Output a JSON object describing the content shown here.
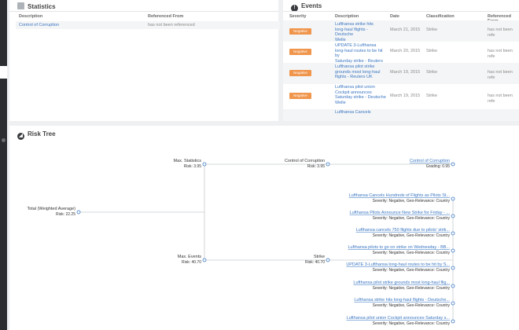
{
  "statistics": {
    "title": "Statistics",
    "columns": [
      "Description",
      "Referenced From"
    ],
    "rows": [
      {
        "description": "Control of Corruption",
        "referenced_from": "has not been referenced"
      }
    ]
  },
  "events": {
    "title": "Events",
    "columns": [
      "Severity",
      "Description",
      "Date",
      "Classification",
      "Referenced From"
    ],
    "rows": [
      {
        "severity": "Negative",
        "description": [
          "Lufthansa strike hits",
          "long-haul flights - Deutsche",
          "Welle"
        ],
        "date": "March 21, 2015",
        "classification": "Strike",
        "referenced_from": "has not been refe"
      },
      {
        "severity": "Negative",
        "description": [
          "UPDATE 3-Lufthansa",
          "long-haul routes to be hit by",
          "Saturday strike - Reuters"
        ],
        "date": "March 20, 2015",
        "classification": "Strike",
        "referenced_from": "has not been refe"
      },
      {
        "severity": "Negative",
        "description": [
          "Lufthansa pilot strike",
          "grounds most long-haul",
          "flights - Reuters UK"
        ],
        "date": "March 19, 2015",
        "classification": "Strike",
        "referenced_from": "has not been refe"
      },
      {
        "severity": "Negative",
        "description": [
          "Lufthansa pilot union",
          "Cockpit announces",
          "Saturday strike - Deutsche",
          "Welle"
        ],
        "date": "March 19, 2015",
        "classification": "Strike",
        "referenced_from": "has not been refe"
      },
      {
        "severity": "",
        "description": [
          "Lufthansa Cancels"
        ],
        "date": "",
        "classification": "",
        "referenced_from": ""
      }
    ]
  },
  "risk_tree": {
    "title": "Risk Tree",
    "root": {
      "label": "Total (Weighted Average)",
      "sub": "Risk: 22.25"
    },
    "max_statistics": {
      "label": "Max. Statistics",
      "sub": "Risk: 3.95"
    },
    "max_events": {
      "label": "Max. Events",
      "sub": "Risk: 40.70"
    },
    "control": {
      "label": "Control of Corruption",
      "sub": "Risk: 3.95"
    },
    "strike": {
      "label": "Strike",
      "sub": "Risk: 40.70"
    },
    "control_leaf": {
      "label": "Control of Corruption",
      "sub": "Grading: 0.95"
    },
    "event_leaves": [
      {
        "label": "Lufthansa Cancels Hundreds of Flights as Pilots St...",
        "sub": "Severity: Negative, Geo-Relevance: Country"
      },
      {
        "label": "Lufthansa Pilots Announce New Strike for Friday - ...",
        "sub": "Severity: Negative, Geo-Relevance: Country"
      },
      {
        "label": "Lufthansa cancels 750 flights due to pilots' strik...",
        "sub": "Severity: Negative, Geo-Relevance: Country"
      },
      {
        "label": "Lufthansa pilots to go on strike on Wednesday - BB...",
        "sub": "Severity: Negative, Geo-Relevance: Country"
      },
      {
        "label": "UPDATE 3-Lufthansa long-haul routes to be hit by S...",
        "sub": "Severity: Negative, Geo-Relevance: Country"
      },
      {
        "label": "Lufthansa pilot strike grounds most long-haul flig...",
        "sub": "Severity: Negative, Geo-Relevance: Country"
      },
      {
        "label": "Lufthansa strike hits long-haul flights - Deutsche...",
        "sub": "Severity: Negative, Geo-Relevance: Country"
      },
      {
        "label": "Lufthansa pilot union Cockpit announces Saturday s...",
        "sub": "Severity: Negative, Geo-Relevance: Country"
      }
    ]
  },
  "colors": {
    "accent": "#3a76c2",
    "badge": "#f0954c",
    "sidebar": "#2b2d31",
    "line": "#c7cbcf"
  }
}
